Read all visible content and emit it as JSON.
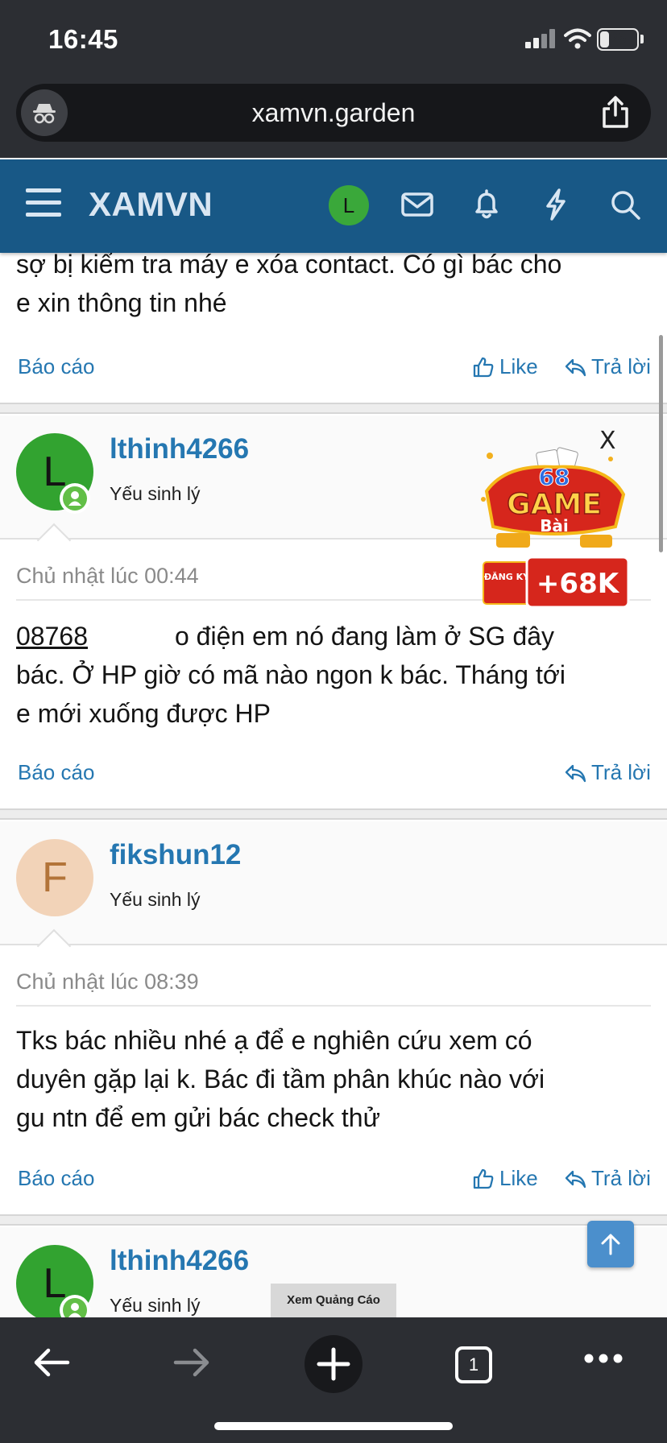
{
  "status_bar": {
    "time": "16:45",
    "battery": "26",
    "battery_level": 0.26
  },
  "browser": {
    "url": "xamvn.garden"
  },
  "site": {
    "logo": "XAMVN",
    "avatar_initial": "L",
    "colors": {
      "header": "#185886",
      "link": "#2577b1"
    }
  },
  "posts": [
    {
      "body_lines": [
        "sợ bị kiểm tra máy e xóa contact. Có gì bác cho",
        "e xin thông tin nhé"
      ],
      "report": "Báo cáo",
      "like": "Like",
      "reply": "Trả lời"
    },
    {
      "username": "lthinh4266",
      "avatar_initial": "L",
      "user_title": "Yếu sinh lý",
      "date": "Chủ nhật lúc 00:44",
      "phone_fragment": "08768",
      "body_line1_rest": "o điện em nó đang làm ở SG đây",
      "body_lines": [
        "bác. Ở HP giờ có mã nào ngon k bác. Tháng tới",
        "e mới xuống được HP"
      ],
      "report": "Báo cáo",
      "reply": "Trả lời"
    },
    {
      "username": "fikshun12",
      "avatar_initial": "F",
      "user_title": "Yếu sinh lý",
      "date": "Chủ nhật lúc 08:39",
      "body_lines": [
        "Tks bác nhiều nhé ạ để e nghiên cứu xem có",
        "duyên gặp lại k. Bác đi tầm phân khúc nào với",
        "gu ntn để em gửi bác check thử"
      ],
      "report": "Báo cáo",
      "like": "Like",
      "reply": "Trả lời"
    },
    {
      "username": "lthinh4266",
      "avatar_initial": "L",
      "user_title": "Yếu sinh lý"
    }
  ],
  "ad": {
    "close": "X",
    "line1": "68",
    "line2": "GAME",
    "line3": "Bài",
    "badge": "ĐĂNG KÝ",
    "bonus": "+68K",
    "view_ad_label": "Xem Quảng Cáo"
  },
  "toolbar": {
    "tab_count": "1"
  }
}
